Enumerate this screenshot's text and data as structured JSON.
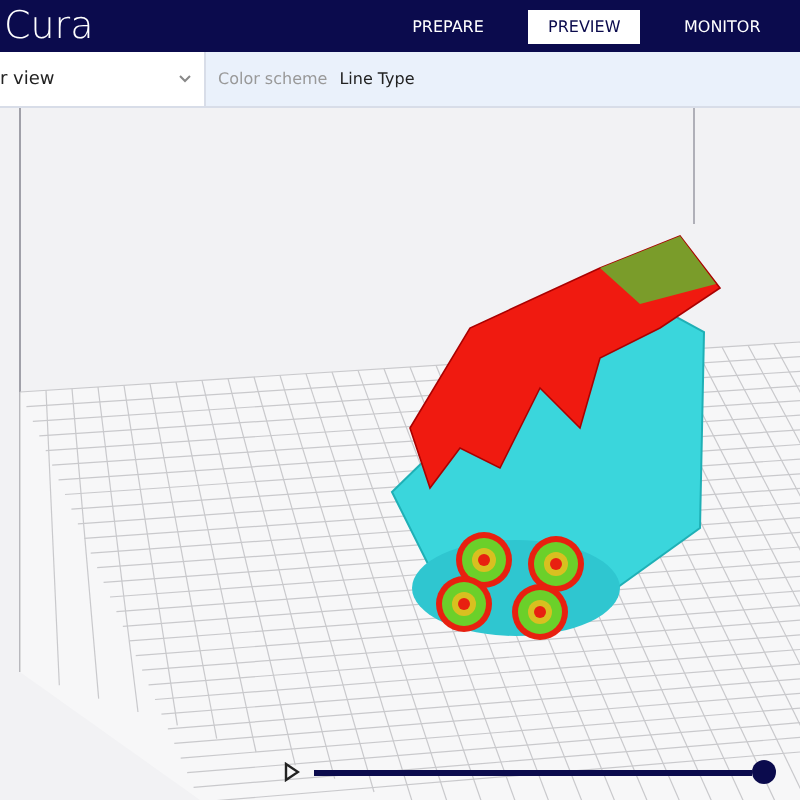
{
  "header": {
    "logo": "Cura",
    "tabs": [
      {
        "label": "PREPARE",
        "selected": false
      },
      {
        "label": "PREVIEW",
        "selected": true
      },
      {
        "label": "MONITOR",
        "selected": false
      }
    ]
  },
  "toolbar": {
    "view_select": "r view",
    "color_scheme_label": "Color scheme",
    "color_scheme_value": "Line Type"
  },
  "layer_slider": {
    "level": 1
  }
}
